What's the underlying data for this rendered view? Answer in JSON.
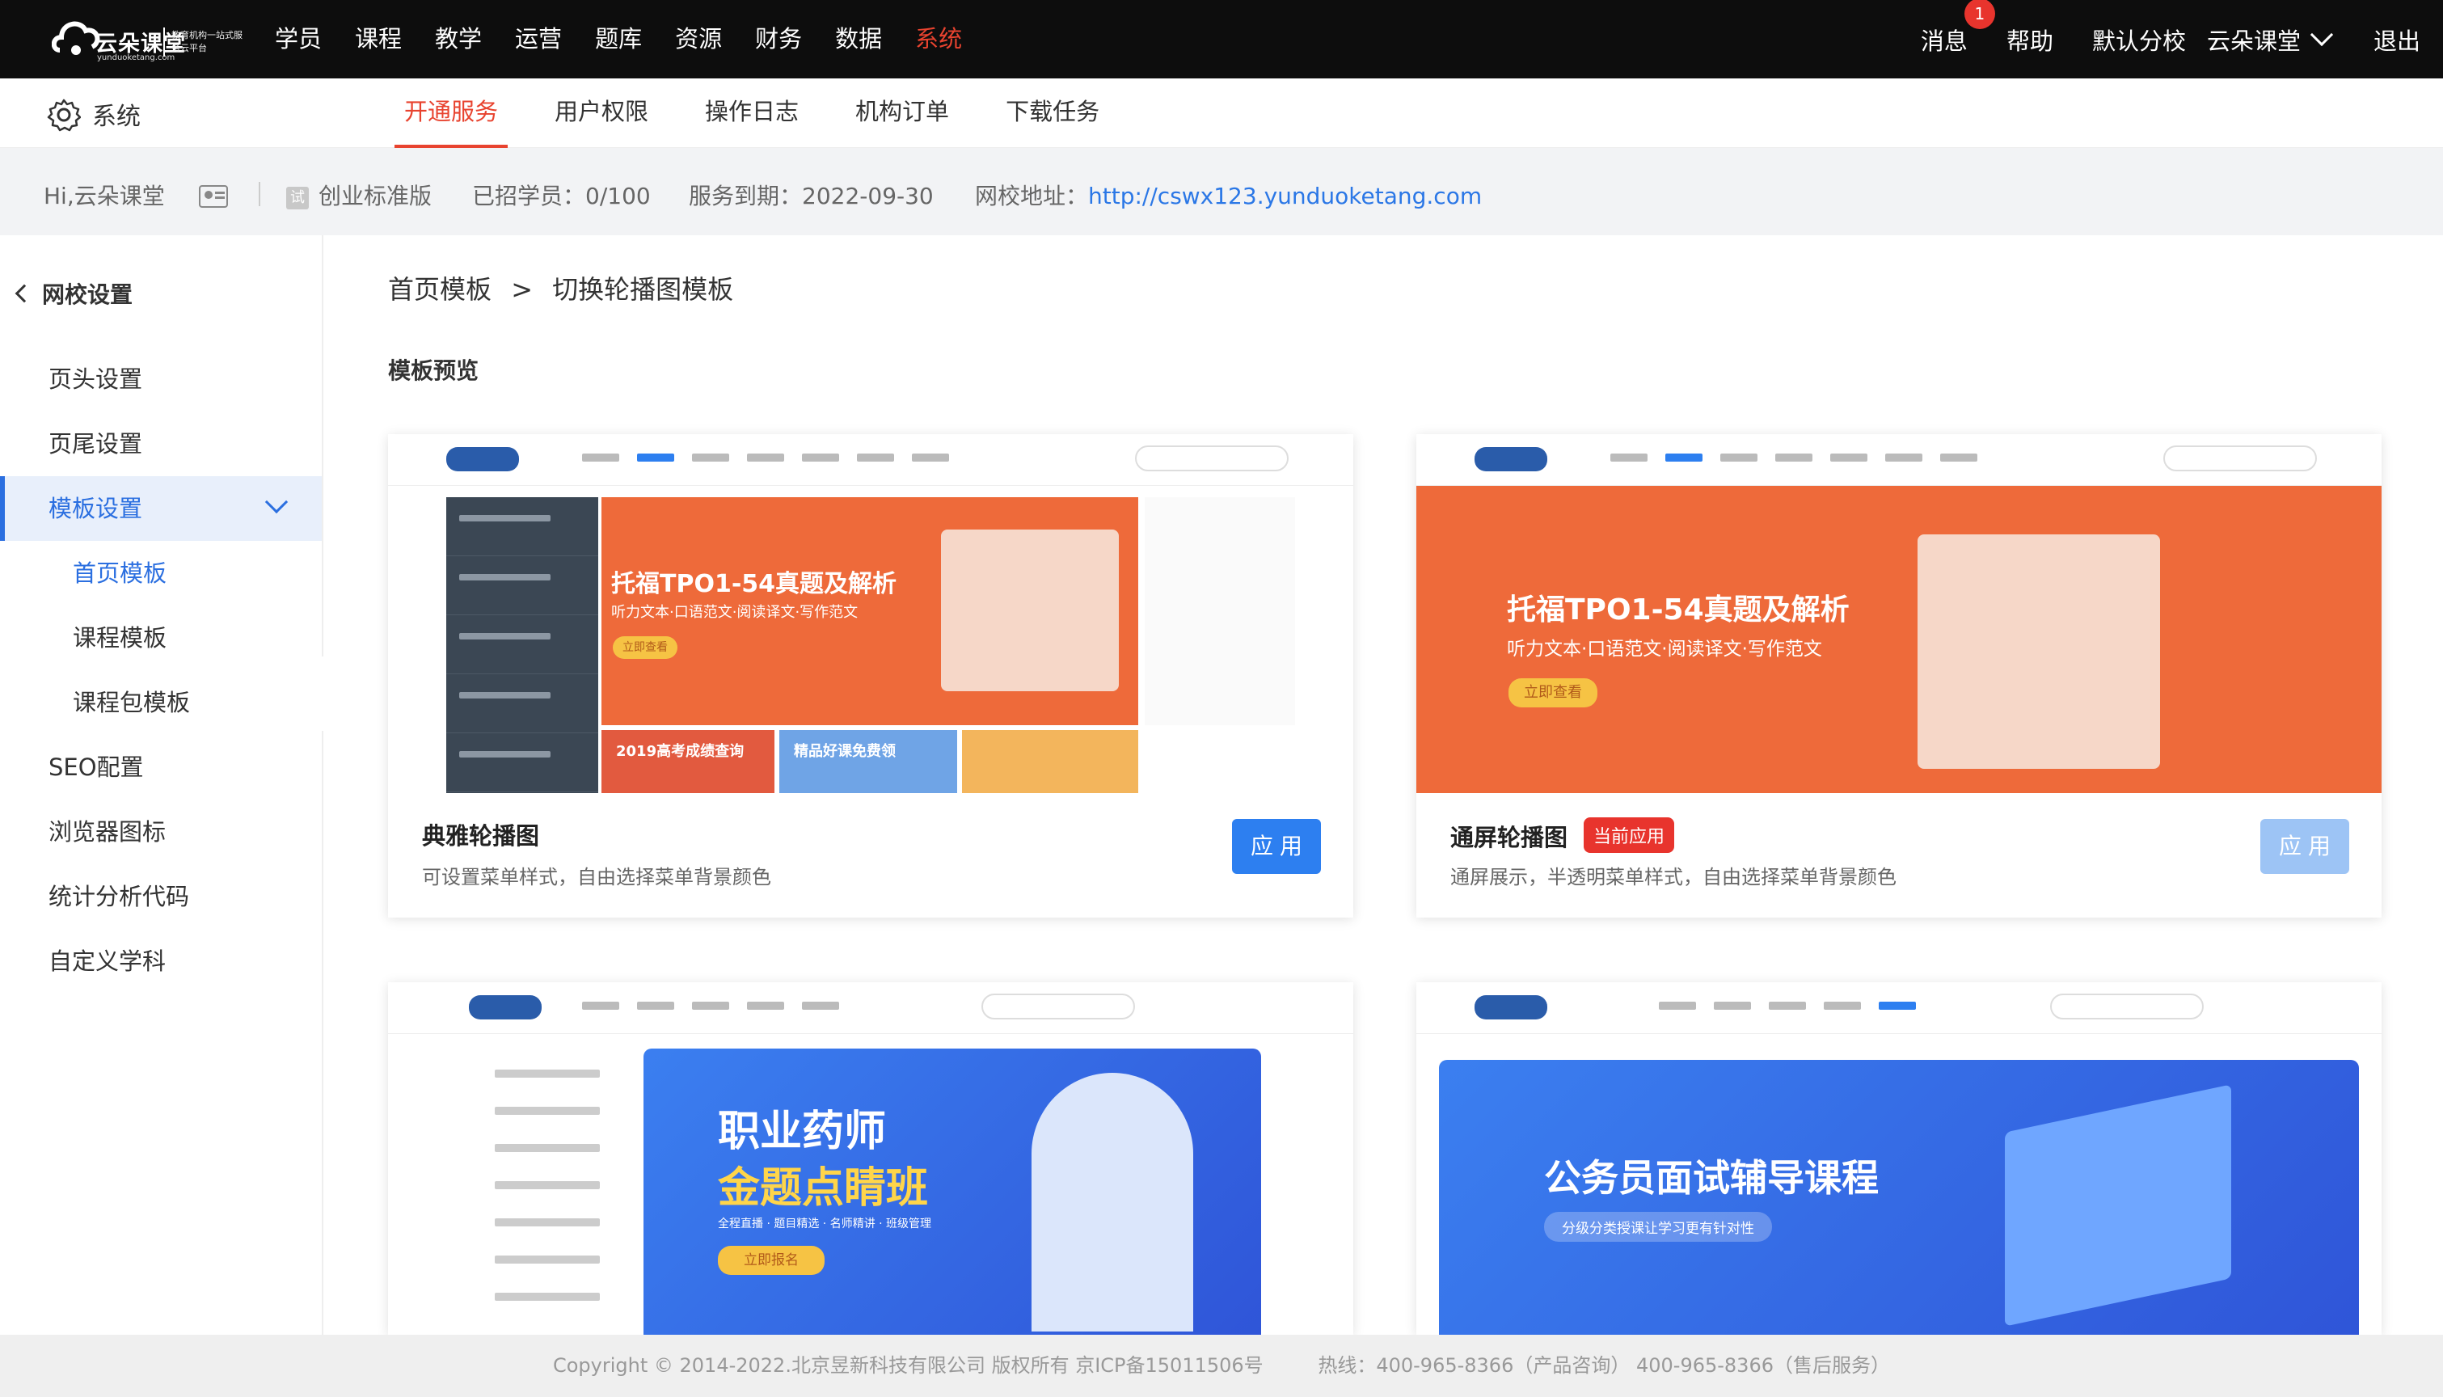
{
  "topnav": {
    "brand": "云朵课堂",
    "domain": "yunduoketang.com",
    "slogan": "教育机构一站式服务云平台",
    "menu": [
      "学员",
      "课程",
      "教学",
      "运营",
      "题库",
      "资源",
      "财务",
      "数据",
      "系统"
    ],
    "active_menu": "系统",
    "messages_label": "消息",
    "messages_count": "1",
    "help_label": "帮助",
    "branch_label": "默认分校",
    "account_label": "云朵课堂",
    "logout_label": "退出"
  },
  "subnav": {
    "section_title": "系统",
    "tabs": [
      "开通服务",
      "用户权限",
      "操作日志",
      "机构订单",
      "下载任务"
    ],
    "active_tab": "开通服务"
  },
  "infobar": {
    "greeting": "Hi,云朵课堂",
    "plan_icon": "试",
    "plan": "创业标准版",
    "students_label": "已招学员：",
    "students_value": "0/100",
    "expiry_label": "服务到期：",
    "expiry_value": "2022-09-30",
    "site_label": "网校地址：",
    "site_url": "http://cswx123.yunduoketang.com"
  },
  "sidebar": {
    "back_label": "网校设置",
    "items": [
      {
        "label": "页头设置"
      },
      {
        "label": "页尾设置"
      },
      {
        "label": "模板设置"
      },
      {
        "label": "首页模板"
      },
      {
        "label": "课程模板"
      },
      {
        "label": "课程包模板"
      },
      {
        "label": "SEO配置"
      },
      {
        "label": "浏览器图标"
      },
      {
        "label": "统计分析代码"
      },
      {
        "label": "自定义学科"
      }
    ],
    "collapse_glyph": "«"
  },
  "content": {
    "breadcrumb_root": "首页模板",
    "breadcrumb_sep": ">",
    "breadcrumb_current": "切换轮播图模板",
    "section_title": "模板预览",
    "cards": [
      {
        "name": "典雅轮播图",
        "desc": "可设置菜单样式，自由选择菜单背景颜色",
        "apply_label": "应用",
        "banner_title": "托福TPO1-54真题及解析",
        "banner_sub": "听力文本·口语范文·阅读译文·写作范文",
        "banner_btn": "立即查看",
        "promo_1": "2019高考成绩查询",
        "promo_2": "精品好课免费领"
      },
      {
        "name": "通屏轮播图",
        "tag": "当前应用",
        "desc": "通屏展示，半透明菜单样式，自由选择菜单背景颜色",
        "apply_label": "应用",
        "banner_title": "托福TPO1-54真题及解析",
        "banner_sub": "听力文本·口语范文·阅读译文·写作范文",
        "banner_btn": "立即查看"
      },
      {
        "banner_title_1": "职业药师",
        "banner_title_2": "金题点睛班",
        "banner_sub": "全程直播 · 题目精选 · 名师精讲 · 班级管理",
        "banner_btn": "立即报名"
      },
      {
        "banner_title": "公务员面试辅导课程",
        "banner_sub": "分级分类授课让学习更有针对性"
      }
    ]
  },
  "footer": {
    "copyright": "Copyright © 2014-2022.北京昱新科技有限公司 版权所有 京ICP备15011506号",
    "hotline": "热线：400-965-8366（产品咨询） 400-965-8366（售后服务）"
  },
  "colors": {
    "accent_red": "#e8432f",
    "link_blue": "#2b77e6",
    "apply_blue": "#2d7ff0"
  }
}
